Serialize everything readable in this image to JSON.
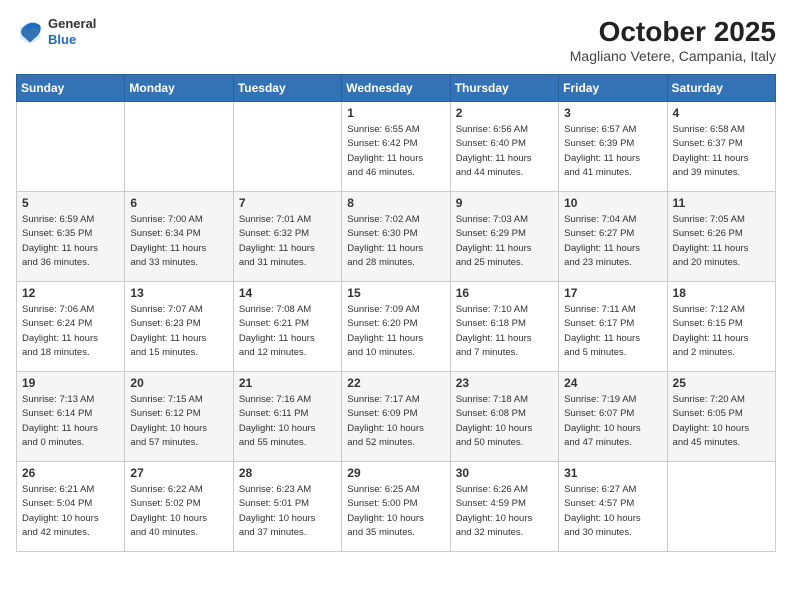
{
  "header": {
    "logo": {
      "general": "General",
      "blue": "Blue"
    },
    "title": "October 2025",
    "subtitle": "Magliano Vetere, Campania, Italy"
  },
  "weekdays": [
    "Sunday",
    "Monday",
    "Tuesday",
    "Wednesday",
    "Thursday",
    "Friday",
    "Saturday"
  ],
  "weeks": [
    [
      {
        "day": "",
        "info": ""
      },
      {
        "day": "",
        "info": ""
      },
      {
        "day": "",
        "info": ""
      },
      {
        "day": "1",
        "info": "Sunrise: 6:55 AM\nSunset: 6:42 PM\nDaylight: 11 hours\nand 46 minutes."
      },
      {
        "day": "2",
        "info": "Sunrise: 6:56 AM\nSunset: 6:40 PM\nDaylight: 11 hours\nand 44 minutes."
      },
      {
        "day": "3",
        "info": "Sunrise: 6:57 AM\nSunset: 6:39 PM\nDaylight: 11 hours\nand 41 minutes."
      },
      {
        "day": "4",
        "info": "Sunrise: 6:58 AM\nSunset: 6:37 PM\nDaylight: 11 hours\nand 39 minutes."
      }
    ],
    [
      {
        "day": "5",
        "info": "Sunrise: 6:59 AM\nSunset: 6:35 PM\nDaylight: 11 hours\nand 36 minutes."
      },
      {
        "day": "6",
        "info": "Sunrise: 7:00 AM\nSunset: 6:34 PM\nDaylight: 11 hours\nand 33 minutes."
      },
      {
        "day": "7",
        "info": "Sunrise: 7:01 AM\nSunset: 6:32 PM\nDaylight: 11 hours\nand 31 minutes."
      },
      {
        "day": "8",
        "info": "Sunrise: 7:02 AM\nSunset: 6:30 PM\nDaylight: 11 hours\nand 28 minutes."
      },
      {
        "day": "9",
        "info": "Sunrise: 7:03 AM\nSunset: 6:29 PM\nDaylight: 11 hours\nand 25 minutes."
      },
      {
        "day": "10",
        "info": "Sunrise: 7:04 AM\nSunset: 6:27 PM\nDaylight: 11 hours\nand 23 minutes."
      },
      {
        "day": "11",
        "info": "Sunrise: 7:05 AM\nSunset: 6:26 PM\nDaylight: 11 hours\nand 20 minutes."
      }
    ],
    [
      {
        "day": "12",
        "info": "Sunrise: 7:06 AM\nSunset: 6:24 PM\nDaylight: 11 hours\nand 18 minutes."
      },
      {
        "day": "13",
        "info": "Sunrise: 7:07 AM\nSunset: 6:23 PM\nDaylight: 11 hours\nand 15 minutes."
      },
      {
        "day": "14",
        "info": "Sunrise: 7:08 AM\nSunset: 6:21 PM\nDaylight: 11 hours\nand 12 minutes."
      },
      {
        "day": "15",
        "info": "Sunrise: 7:09 AM\nSunset: 6:20 PM\nDaylight: 11 hours\nand 10 minutes."
      },
      {
        "day": "16",
        "info": "Sunrise: 7:10 AM\nSunset: 6:18 PM\nDaylight: 11 hours\nand 7 minutes."
      },
      {
        "day": "17",
        "info": "Sunrise: 7:11 AM\nSunset: 6:17 PM\nDaylight: 11 hours\nand 5 minutes."
      },
      {
        "day": "18",
        "info": "Sunrise: 7:12 AM\nSunset: 6:15 PM\nDaylight: 11 hours\nand 2 minutes."
      }
    ],
    [
      {
        "day": "19",
        "info": "Sunrise: 7:13 AM\nSunset: 6:14 PM\nDaylight: 11 hours\nand 0 minutes."
      },
      {
        "day": "20",
        "info": "Sunrise: 7:15 AM\nSunset: 6:12 PM\nDaylight: 10 hours\nand 57 minutes."
      },
      {
        "day": "21",
        "info": "Sunrise: 7:16 AM\nSunset: 6:11 PM\nDaylight: 10 hours\nand 55 minutes."
      },
      {
        "day": "22",
        "info": "Sunrise: 7:17 AM\nSunset: 6:09 PM\nDaylight: 10 hours\nand 52 minutes."
      },
      {
        "day": "23",
        "info": "Sunrise: 7:18 AM\nSunset: 6:08 PM\nDaylight: 10 hours\nand 50 minutes."
      },
      {
        "day": "24",
        "info": "Sunrise: 7:19 AM\nSunset: 6:07 PM\nDaylight: 10 hours\nand 47 minutes."
      },
      {
        "day": "25",
        "info": "Sunrise: 7:20 AM\nSunset: 6:05 PM\nDaylight: 10 hours\nand 45 minutes."
      }
    ],
    [
      {
        "day": "26",
        "info": "Sunrise: 6:21 AM\nSunset: 5:04 PM\nDaylight: 10 hours\nand 42 minutes."
      },
      {
        "day": "27",
        "info": "Sunrise: 6:22 AM\nSunset: 5:02 PM\nDaylight: 10 hours\nand 40 minutes."
      },
      {
        "day": "28",
        "info": "Sunrise: 6:23 AM\nSunset: 5:01 PM\nDaylight: 10 hours\nand 37 minutes."
      },
      {
        "day": "29",
        "info": "Sunrise: 6:25 AM\nSunset: 5:00 PM\nDaylight: 10 hours\nand 35 minutes."
      },
      {
        "day": "30",
        "info": "Sunrise: 6:26 AM\nSunset: 4:59 PM\nDaylight: 10 hours\nand 32 minutes."
      },
      {
        "day": "31",
        "info": "Sunrise: 6:27 AM\nSunset: 4:57 PM\nDaylight: 10 hours\nand 30 minutes."
      },
      {
        "day": "",
        "info": ""
      }
    ]
  ]
}
